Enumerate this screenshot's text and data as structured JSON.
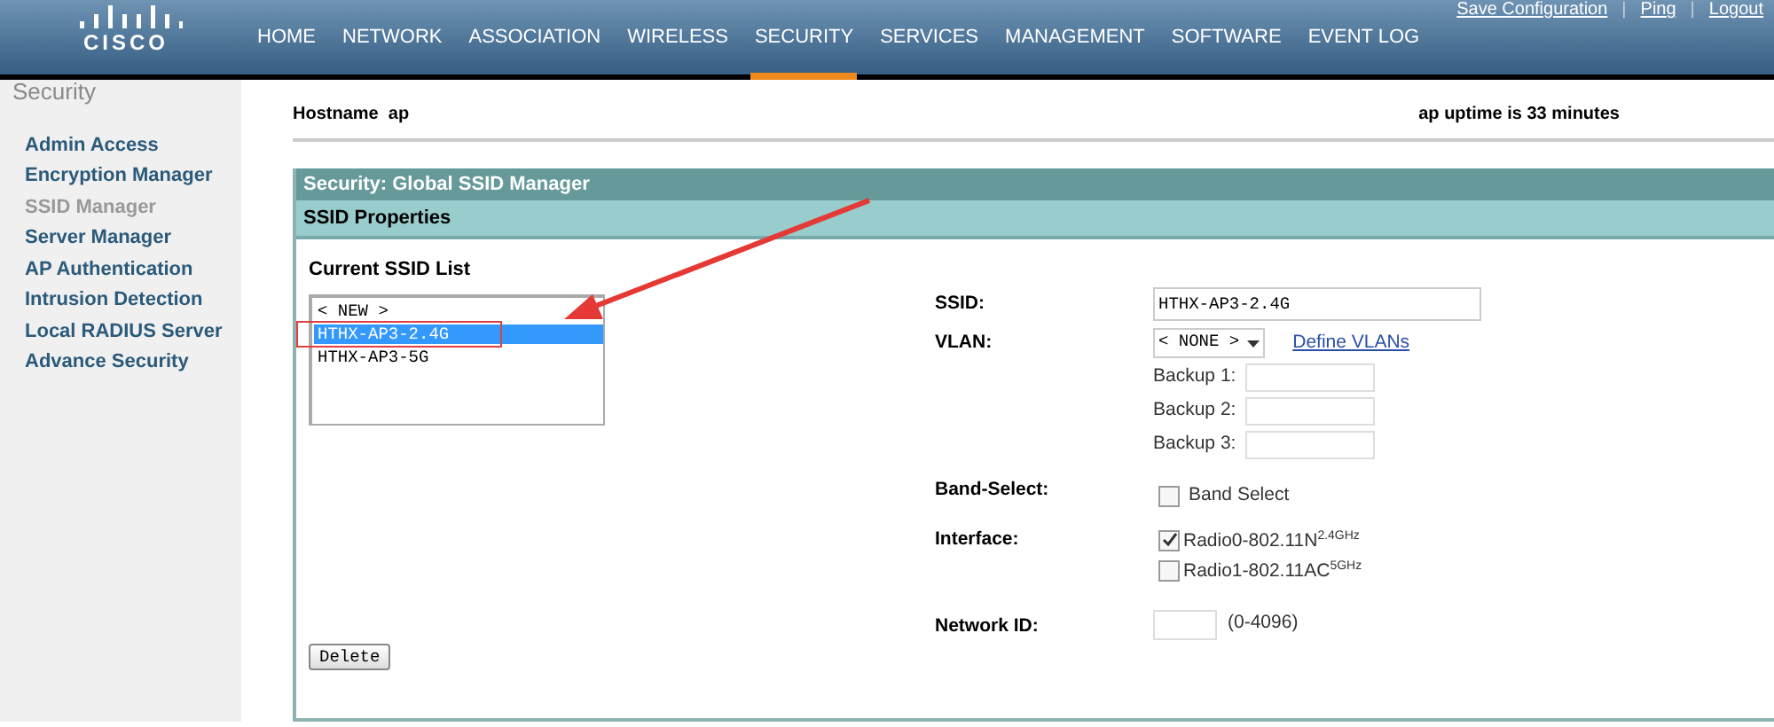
{
  "header": {
    "logo": "CISCO",
    "separator": "|",
    "links": [
      "Save Configuration",
      "Ping",
      "Logout"
    ],
    "nav": [
      {
        "label": "HOME",
        "selected": false
      },
      {
        "label": "NETWORK",
        "selected": false
      },
      {
        "label": "ASSOCIATION",
        "selected": false
      },
      {
        "label": "WIRELESS",
        "selected": false
      },
      {
        "label": "SECURITY",
        "selected": true
      },
      {
        "label": "SERVICES",
        "selected": false
      },
      {
        "label": "MANAGEMENT",
        "selected": false
      },
      {
        "label": "SOFTWARE",
        "selected": false
      },
      {
        "label": "EVENT LOG",
        "selected": false
      }
    ]
  },
  "sidebar": {
    "title": "Security",
    "items": [
      {
        "label": "Admin Access",
        "selected": false
      },
      {
        "label": "Encryption Manager",
        "selected": false
      },
      {
        "label": "SSID Manager",
        "selected": true
      },
      {
        "label": "Server Manager",
        "selected": false
      },
      {
        "label": "AP Authentication",
        "selected": false
      },
      {
        "label": "Intrusion Detection",
        "selected": false
      },
      {
        "label": "Local RADIUS Server",
        "selected": false
      },
      {
        "label": "Advance Security",
        "selected": false
      }
    ]
  },
  "hostname": "Hostname  ap",
  "uptime": "ap uptime is 33 minutes",
  "panel": {
    "title": "Security: Global SSID Manager",
    "subtitle": "SSID Properties",
    "list": {
      "label": "Current SSID List",
      "items": [
        {
          "label": "< NEW >",
          "selected": false
        },
        {
          "label": "HTHX-AP3-2.4G",
          "selected": true
        },
        {
          "label": "HTHX-AP3-5G",
          "selected": false
        }
      ]
    },
    "delete": "Delete",
    "ssid": {
      "label": "SSID:",
      "value": "HTHX-AP3-2.4G"
    },
    "vlan": {
      "label": "VLAN:",
      "value": "< NONE >",
      "link": "Define VLANs",
      "backups": [
        "Backup 1:",
        "Backup 2:",
        "Backup 3:"
      ]
    },
    "band_select": {
      "label": "Band-Select:",
      "option": "Band Select",
      "checked": false
    },
    "interface": {
      "label": "Interface:",
      "options": [
        {
          "label": "Radio0-802.11N$^{2.4GHz}$",
          "checked": true
        },
        {
          "label": "Radio1-802.11AC$^{5GHz}$",
          "checked": false
        }
      ]
    },
    "network_id": {
      "label": "Network ID:",
      "hint": "(0-4096)"
    }
  }
}
